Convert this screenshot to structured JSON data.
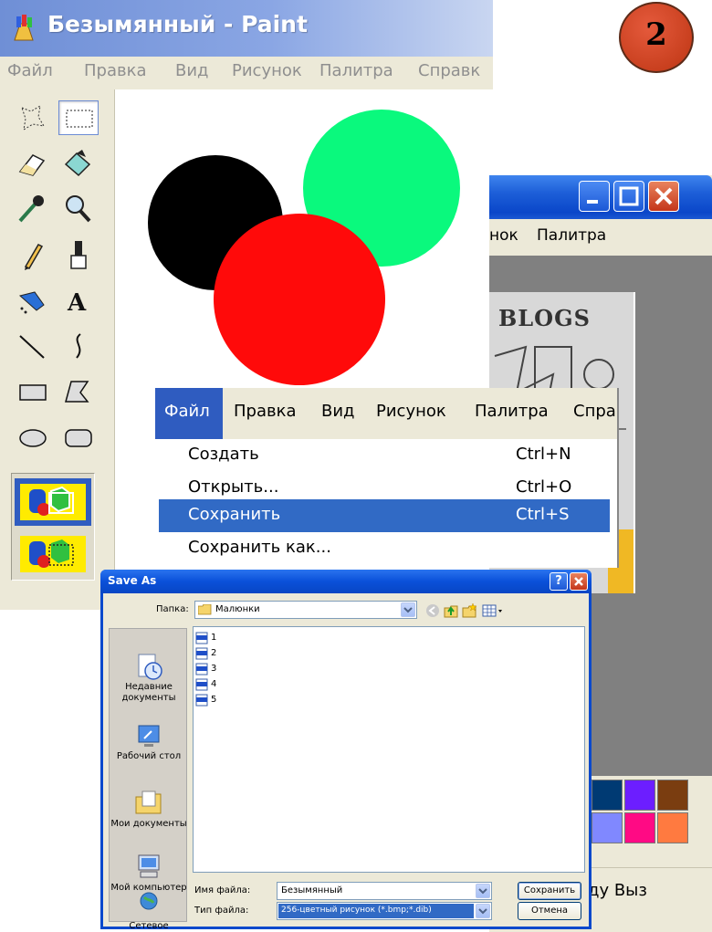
{
  "badge": {
    "number": "2"
  },
  "paint_back": {
    "title": "Безымянный - Paint",
    "menu": [
      "Файл",
      "Правка",
      "Вид",
      "Рисунок",
      "Палитра",
      "Справк"
    ],
    "canvas_colors": {
      "black": "#000000",
      "green": "#0af97d",
      "red": "#ff0a0a"
    }
  },
  "paint_front": {
    "menu": [
      "нок",
      "Палитра"
    ],
    "image_text": "BLOGS",
    "palette": [
      "#003a73",
      "#6c1eff",
      "#7a3d10",
      "#8088ff",
      "#ff0a84",
      "#ff7a40"
    ],
    "status_text": "ду Выз"
  },
  "file_menu": {
    "bar": [
      "Файл",
      "Правка",
      "Вид",
      "Рисунок",
      "Палитра",
      "Спра"
    ],
    "items": [
      {
        "label": "Создать",
        "shortcut": "Ctrl+N"
      },
      {
        "label": "Открыть...",
        "shortcut": "Ctrl+O"
      },
      {
        "label": "Сохранить",
        "shortcut": "Ctrl+S"
      },
      {
        "label": "Сохранить как...",
        "shortcut": ""
      }
    ],
    "highlighted_index": 2
  },
  "save_as": {
    "title": "Save As",
    "help_label": "?",
    "look_in_label": "Папка:",
    "look_in_value": "Малюнки",
    "places": [
      "Недавние документы",
      "Рабочий стол",
      "Мои документы",
      "Мой компьютер",
      "Сетевое"
    ],
    "files": [
      "1",
      "2",
      "3",
      "4",
      "5"
    ],
    "file_name_label": "Имя файла:",
    "file_name_value": "Безымянный",
    "file_type_label": "Тип файла:",
    "file_type_value": "256-цветный рисунок (*.bmp;*.dib)",
    "save_button": "Сохранить",
    "cancel_button": "Отмена"
  }
}
